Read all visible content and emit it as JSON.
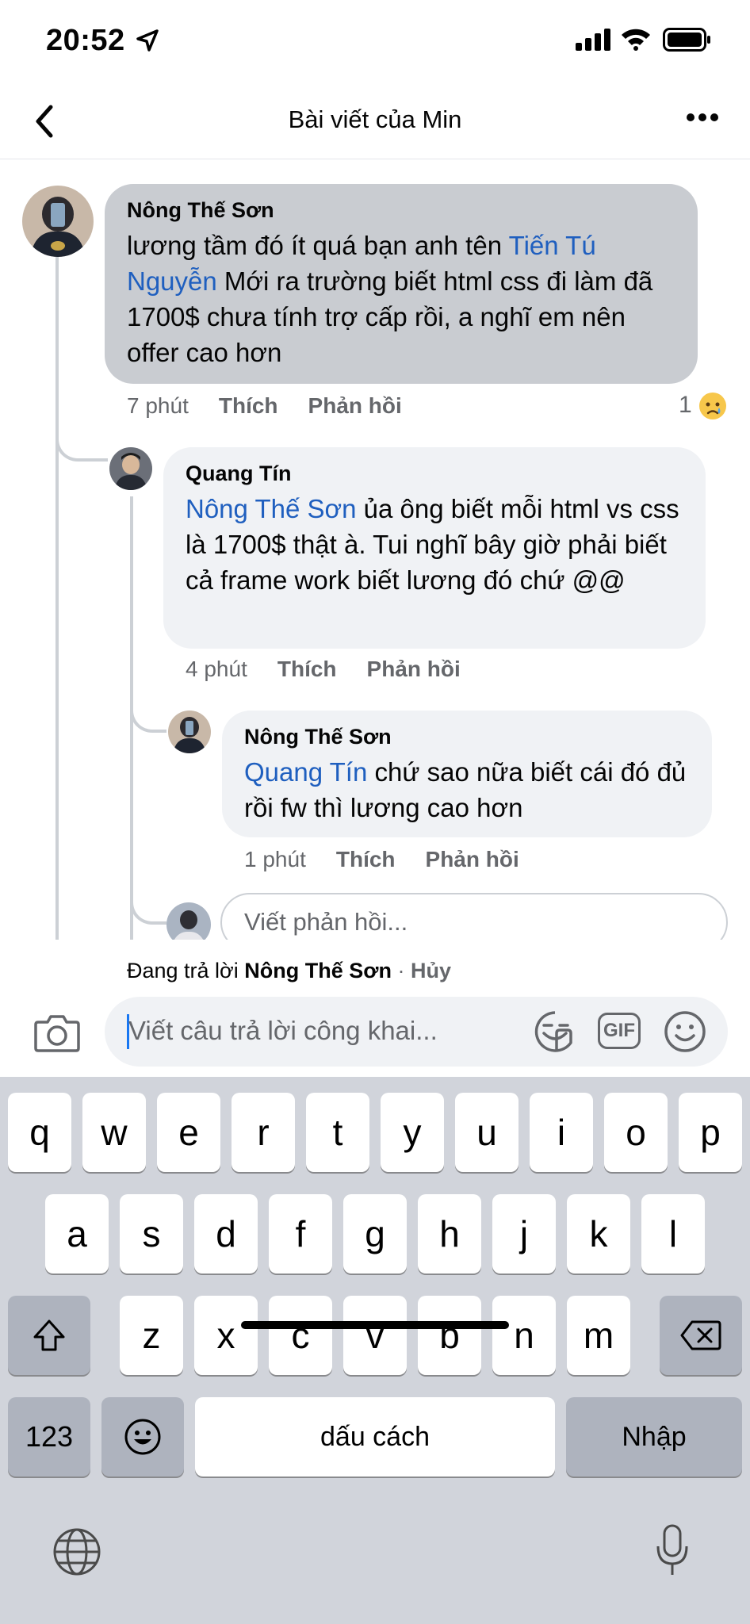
{
  "status_bar": {
    "time": "20:52"
  },
  "nav": {
    "title": "Bài viết của Min"
  },
  "comments": [
    {
      "author": "Nông Thế Sơn",
      "text_before": "lương tầm đó ít quá bạn anh tên ",
      "mention": "Tiến Tú Nguyễn",
      "text_after": " Mới ra trường biết html css đi làm đã 1700$ chưa tính trợ cấp rồi, a nghĩ em nên offer cao hơn",
      "time": "7 phút",
      "like": "Thích",
      "reply": "Phản hồi",
      "reaction_count": "1"
    },
    {
      "author": "Quang Tín",
      "mention": "Nông Thế Sơn",
      "text_after": " ủa ông biết mỗi html vs css là 1700$ thật à. Tui nghĩ bây giờ phải biết cả frame work biết lương đó chứ @@",
      "time": "4 phút",
      "like": "Thích",
      "reply": "Phản hồi"
    },
    {
      "author": "Nông Thế Sơn",
      "mention": "Quang Tín",
      "text_after": " chứ sao nữa biết cái đó đủ rồi fw thì lương cao hơn",
      "time": "1 phút",
      "like": "Thích",
      "reply": "Phản hồi"
    }
  ],
  "reply_box": {
    "placeholder": "Viết phản hồi..."
  },
  "replying": {
    "prefix": "Đang trả lời ",
    "name": "Nông Thế Sơn",
    "separator": " · ",
    "cancel": "Hủy"
  },
  "composer": {
    "placeholder": "Viết câu trả lời công khai...",
    "gif_label": "GIF"
  },
  "keyboard": {
    "row1": [
      "q",
      "w",
      "e",
      "r",
      "t",
      "y",
      "u",
      "i",
      "o",
      "p"
    ],
    "row2": [
      "a",
      "s",
      "d",
      "f",
      "g",
      "h",
      "j",
      "k",
      "l"
    ],
    "row3": [
      "z",
      "x",
      "c",
      "v",
      "b",
      "n",
      "m"
    ],
    "numbers": "123",
    "space": "dấu cách",
    "return": "Nhập"
  },
  "icons": [
    "location-arrow-icon",
    "signal-icon",
    "wifi-icon",
    "battery-icon",
    "back-icon",
    "more-icon",
    "camera-icon",
    "sticker-icon",
    "gif-icon",
    "smile-icon",
    "shift-icon",
    "backspace-icon",
    "emoji-icon",
    "globe-icon",
    "mic-icon",
    "sad-reaction-icon"
  ],
  "colors": {
    "mention": "#1f5fbf",
    "bubble_highlight": "#c9ccd1",
    "bubble": "#f0f2f5",
    "keyboard_bg": "#d1d4db"
  }
}
